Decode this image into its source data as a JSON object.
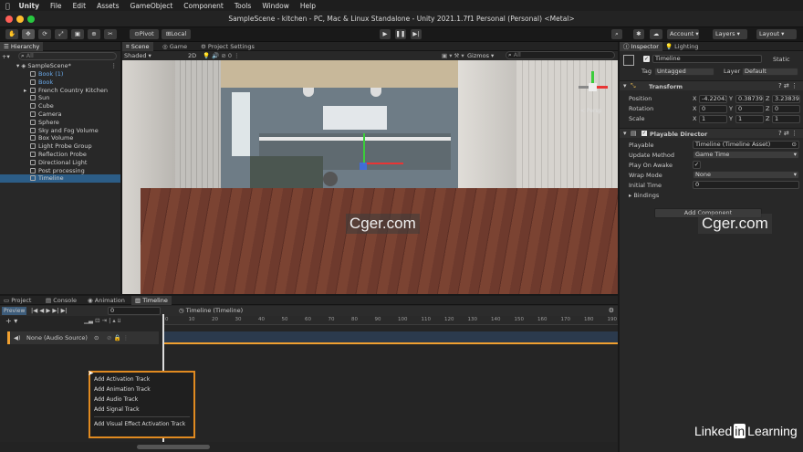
{
  "menubar": {
    "apple": "",
    "app": "Unity",
    "items": [
      "File",
      "Edit",
      "Assets",
      "GameObject",
      "Component",
      "Tools",
      "Window",
      "Help"
    ]
  },
  "window": {
    "title": "SampleScene - kitchen - PC, Mac & Linux Standalone - Unity 2021.1.7f1 Personal (Personal) <Metal>"
  },
  "toolbar": {
    "pivot": "Pivot",
    "local": "Local",
    "account": "Account",
    "layers": "Layers",
    "layout": "Layout"
  },
  "hierarchy": {
    "tab": "Hierarchy",
    "search_placeholder": "All",
    "scene": "SampleScene*",
    "items": [
      "Book (1)",
      "Book",
      "French Country Kitchen",
      "Sun",
      "Cube",
      "Camera",
      "Sphere",
      "Sky and Fog Volume",
      "Box Volume",
      "Light Probe Group",
      "Reflection Probe",
      "Directional Light",
      "Post processing",
      "Timeline"
    ]
  },
  "scene_view": {
    "tabs": [
      "Scene",
      "Game",
      "Project Settings"
    ],
    "shading": "Shaded",
    "mode2d": "2D",
    "gizmos": "Gizmos",
    "search_placeholder": "All",
    "persp": "< Persp",
    "light_count": "0"
  },
  "inspector": {
    "tabs": [
      "Inspector",
      "Lighting"
    ],
    "object_name": "Timeline",
    "static": "Static",
    "tag_label": "Tag",
    "tag": "Untagged",
    "layer_label": "Layer",
    "layer": "Default",
    "transform": {
      "title": "Transform",
      "position_label": "Position",
      "position": {
        "x": "-4.22043",
        "y": "0.38739",
        "z": "3.23839"
      },
      "rotation_label": "Rotation",
      "rotation": {
        "x": "0",
        "y": "0",
        "z": "0"
      },
      "scale_label": "Scale",
      "scale": {
        "x": "1",
        "y": "1",
        "z": "1"
      }
    },
    "director": {
      "title": "Playable Director",
      "playable_label": "Playable",
      "playable": "Timeline (Timeline Asset)",
      "update_label": "Update Method",
      "update": "Game Time",
      "play_label": "Play On Awake",
      "wrap_label": "Wrap Mode",
      "wrap": "None",
      "init_label": "Initial Time",
      "init": "0",
      "bindings_label": "Bindings"
    },
    "add_component": "Add Component"
  },
  "bottom": {
    "tabs": [
      "Project",
      "Console",
      "Animation",
      "Timeline"
    ],
    "preview": "Preview",
    "frame": "0",
    "asset": "Timeline (Timeline)",
    "ruler": [
      "0",
      "10",
      "20",
      "30",
      "40",
      "50",
      "60",
      "70",
      "80",
      "90",
      "100",
      "110",
      "120",
      "130",
      "140",
      "150",
      "160",
      "170",
      "180",
      "190",
      "200",
      "210",
      "220",
      "230",
      "240",
      "250",
      "260",
      "270",
      "280",
      "290",
      "300",
      "310",
      "320",
      "330",
      "340",
      "350",
      "360",
      "370",
      "380",
      "390",
      "400",
      "410",
      "420",
      "430",
      "440",
      "450",
      "460",
      "470",
      "480",
      "490",
      "500",
      "510",
      "520",
      "530",
      "540",
      "550",
      "560",
      "570",
      "580",
      "590",
      "600",
      "610",
      "620",
      "630",
      "640",
      "650",
      "660",
      "670",
      "680",
      "690",
      "700",
      "710",
      "720",
      "730",
      "740",
      "750",
      "760",
      "770",
      "780",
      "790"
    ],
    "track": "None (Audio Source)"
  },
  "context_menu": [
    "Add Activation Track",
    "Add Animation Track",
    "Add Audio Track",
    "Add Signal Track",
    "Add Visual Effect Activation Track"
  ],
  "watermarks": [
    "Cger.com",
    "Cger.com"
  ],
  "branding": {
    "linked": "Linked",
    "in": "in",
    "learning": "Learning"
  },
  "colors": {
    "accent": "#2b5a8c",
    "highlight": "#f0a030",
    "selection": "#2c5d87"
  }
}
